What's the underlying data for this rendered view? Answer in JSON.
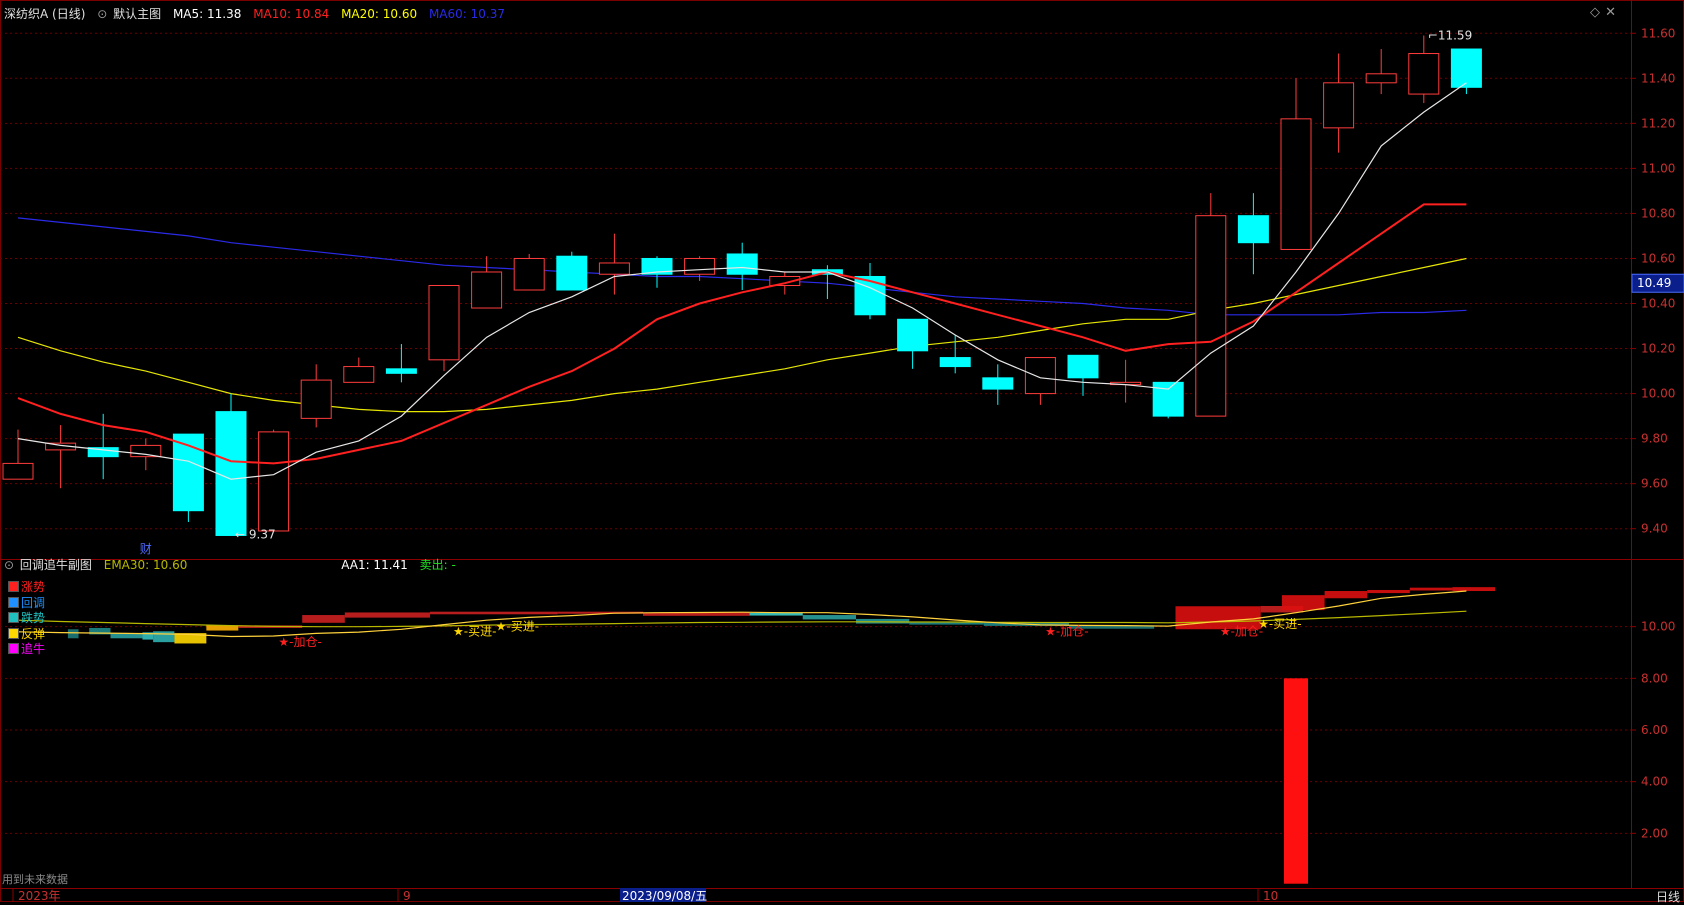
{
  "header": {
    "stock": "深纺织A (日线)",
    "chart_name": "默认主图",
    "indicators": [
      {
        "label": "MA5: 11.38",
        "color": "#ffffff"
      },
      {
        "label": "MA10: 10.84",
        "color": "#ff2020"
      },
      {
        "label": "MA20: 10.60",
        "color": "#ffff00"
      },
      {
        "label": "MA60: 10.37",
        "color": "#1e1ee6"
      }
    ]
  },
  "sub_header": {
    "name": "回调追牛副图",
    "ema": "EMA30: 10.60",
    "aa1": "AA1: 11.41",
    "sell": "卖出: -"
  },
  "legend": [
    {
      "label": "涨势",
      "color": "#ff2020"
    },
    {
      "label": "回调",
      "color": "#1e90ff"
    },
    {
      "label": "跌势",
      "color": "#20c0c0"
    },
    {
      "label": "反弹",
      "color": "#ffd700"
    },
    {
      "label": "追牛",
      "color": "#ff00ff"
    }
  ],
  "footer": {
    "note": "用到未来数据",
    "period_button": "日线",
    "x_labels": [
      "2023年",
      "9",
      "2023/09/08/五",
      "10"
    ]
  },
  "chart_data": {
    "type": "candlestick",
    "main": {
      "yticks": [
        9.4,
        9.6,
        9.8,
        10.0,
        10.2,
        10.4,
        10.6,
        10.8,
        11.0,
        11.2,
        11.4,
        11.6
      ],
      "ylim": [
        9.27,
        11.65
      ],
      "current_price": 10.49,
      "high_label": "11.59",
      "low_label": "9.37",
      "marker_text": "财",
      "candles": [
        {
          "o": 9.62,
          "h": 9.84,
          "l": 9.62,
          "c": 9.69
        },
        {
          "o": 9.75,
          "h": 9.86,
          "l": 9.58,
          "c": 9.78
        },
        {
          "o": 9.76,
          "h": 9.91,
          "l": 9.62,
          "c": 9.72
        },
        {
          "o": 9.72,
          "h": 9.8,
          "l": 9.66,
          "c": 9.77
        },
        {
          "o": 9.82,
          "h": 9.82,
          "l": 9.43,
          "c": 9.48
        },
        {
          "o": 9.92,
          "h": 10.0,
          "l": 9.37,
          "c": 9.37
        },
        {
          "o": 9.39,
          "h": 9.84,
          "l": 9.39,
          "c": 9.83
        },
        {
          "o": 9.89,
          "h": 10.13,
          "l": 9.85,
          "c": 10.06
        },
        {
          "o": 10.05,
          "h": 10.16,
          "l": 10.05,
          "c": 10.12
        },
        {
          "o": 10.11,
          "h": 10.22,
          "l": 10.05,
          "c": 10.09
        },
        {
          "o": 10.15,
          "h": 10.48,
          "l": 10.1,
          "c": 10.48
        },
        {
          "o": 10.38,
          "h": 10.61,
          "l": 10.38,
          "c": 10.54
        },
        {
          "o": 10.46,
          "h": 10.62,
          "l": 10.46,
          "c": 10.6
        },
        {
          "o": 10.61,
          "h": 10.63,
          "l": 10.46,
          "c": 10.46
        },
        {
          "o": 10.53,
          "h": 10.71,
          "l": 10.44,
          "c": 10.58
        },
        {
          "o": 10.6,
          "h": 10.61,
          "l": 10.47,
          "c": 10.53
        },
        {
          "o": 10.53,
          "h": 10.61,
          "l": 10.5,
          "c": 10.6
        },
        {
          "o": 10.62,
          "h": 10.67,
          "l": 10.46,
          "c": 10.53
        },
        {
          "o": 10.48,
          "h": 10.54,
          "l": 10.44,
          "c": 10.52
        },
        {
          "o": 10.55,
          "h": 10.57,
          "l": 10.42,
          "c": 10.53
        },
        {
          "o": 10.52,
          "h": 10.58,
          "l": 10.33,
          "c": 10.35
        },
        {
          "o": 10.33,
          "h": 10.33,
          "l": 10.11,
          "c": 10.19
        },
        {
          "o": 10.16,
          "h": 10.26,
          "l": 10.09,
          "c": 10.12
        },
        {
          "o": 10.07,
          "h": 10.13,
          "l": 9.95,
          "c": 10.02
        },
        {
          "o": 10.0,
          "h": 10.16,
          "l": 9.95,
          "c": 10.16
        },
        {
          "o": 10.17,
          "h": 10.17,
          "l": 9.99,
          "c": 10.07
        },
        {
          "o": 10.04,
          "h": 10.15,
          "l": 9.96,
          "c": 10.05
        },
        {
          "o": 10.05,
          "h": 10.05,
          "l": 9.89,
          "c": 9.9
        },
        {
          "o": 9.9,
          "h": 10.89,
          "l": 9.9,
          "c": 10.79
        },
        {
          "o": 10.79,
          "h": 10.89,
          "l": 10.53,
          "c": 10.67
        },
        {
          "o": 10.64,
          "h": 11.4,
          "l": 10.64,
          "c": 11.22
        },
        {
          "o": 11.18,
          "h": 11.51,
          "l": 11.07,
          "c": 11.38
        },
        {
          "o": 11.38,
          "h": 11.53,
          "l": 11.33,
          "c": 11.42
        },
        {
          "o": 11.33,
          "h": 11.59,
          "l": 11.29,
          "c": 11.51
        },
        {
          "o": 11.53,
          "h": 11.53,
          "l": 11.33,
          "c": 11.36
        }
      ],
      "series": [
        {
          "name": "MA5",
          "color": "#e6e6e6",
          "width": 1.2,
          "values": [
            9.8,
            9.77,
            9.75,
            9.73,
            9.7,
            9.62,
            9.64,
            9.74,
            9.79,
            9.9,
            10.08,
            10.25,
            10.36,
            10.43,
            10.52,
            10.54,
            10.55,
            10.56,
            10.54,
            10.54,
            10.47,
            10.38,
            10.26,
            10.15,
            10.07,
            10.05,
            10.04,
            10.02,
            10.18,
            10.3,
            10.54,
            10.8,
            11.1,
            11.25,
            11.38
          ]
        },
        {
          "name": "MA10",
          "color": "#ff2020",
          "width": 2,
          "values": [
            9.98,
            9.91,
            9.86,
            9.83,
            9.77,
            9.7,
            9.69,
            9.71,
            9.75,
            9.79,
            9.87,
            9.95,
            10.03,
            10.1,
            10.2,
            10.33,
            10.4,
            10.45,
            10.49,
            10.54,
            10.5,
            10.45,
            10.4,
            10.35,
            10.3,
            10.25,
            10.19,
            10.22,
            10.23,
            10.32,
            10.45,
            10.58,
            10.71,
            10.84,
            10.84
          ]
        },
        {
          "name": "MA20",
          "color": "#e6e600",
          "width": 1.2,
          "values": [
            10.25,
            10.19,
            10.14,
            10.1,
            10.05,
            10.0,
            9.97,
            9.95,
            9.93,
            9.92,
            9.92,
            9.93,
            9.95,
            9.97,
            10.0,
            10.02,
            10.05,
            10.08,
            10.11,
            10.15,
            10.18,
            10.21,
            10.23,
            10.25,
            10.28,
            10.31,
            10.33,
            10.33,
            10.37,
            10.4,
            10.44,
            10.48,
            10.52,
            10.56,
            10.6
          ]
        },
        {
          "name": "MA60",
          "color": "#2a2ae8",
          "width": 1.2,
          "values": [
            10.78,
            10.76,
            10.74,
            10.72,
            10.7,
            10.67,
            10.65,
            10.63,
            10.61,
            10.59,
            10.57,
            10.56,
            10.55,
            10.54,
            10.53,
            10.52,
            10.52,
            10.51,
            10.5,
            10.49,
            10.47,
            10.45,
            10.43,
            10.42,
            10.41,
            10.4,
            10.38,
            10.37,
            10.35,
            10.35,
            10.35,
            10.35,
            10.36,
            10.36,
            10.37
          ]
        }
      ]
    },
    "sub": {
      "yticks": [
        2.0,
        4.0,
        6.0,
        8.0,
        10.0
      ],
      "ylim": [
        0.0,
        12.0
      ],
      "aa1_series": {
        "name": "AA1",
        "color": "#ffd23c",
        "values": [
          9.8,
          9.77,
          9.75,
          9.73,
          9.7,
          9.62,
          9.64,
          9.74,
          9.79,
          9.9,
          10.08,
          10.25,
          10.36,
          10.43,
          10.52,
          10.54,
          10.55,
          10.56,
          10.54,
          10.54,
          10.47,
          10.38,
          10.26,
          10.15,
          10.07,
          10.05,
          10.04,
          10.02,
          10.18,
          10.3,
          10.54,
          10.8,
          11.1,
          11.25,
          11.38
        ]
      },
      "ema_series": {
        "name": "EMA30",
        "color": "#b8b800",
        "values": [
          10.25,
          10.2,
          10.16,
          10.12,
          10.08,
          10.04,
          10.01,
          10.0,
          10.0,
          10.01,
          10.03,
          10.06,
          10.08,
          10.1,
          10.12,
          10.14,
          10.16,
          10.17,
          10.18,
          10.19,
          10.19,
          10.18,
          10.18,
          10.17,
          10.16,
          10.16,
          10.16,
          10.15,
          10.18,
          10.22,
          10.28,
          10.35,
          10.43,
          10.51,
          10.6
        ]
      },
      "blocks": [
        {
          "x0": 6,
          "x1": 7,
          "top": 9.9,
          "bot": 9.55,
          "color": "#1e7a7a"
        },
        {
          "x0": 8,
          "x1": 10,
          "top": 9.95,
          "bot": 9.7,
          "color": "#1e8a8a"
        },
        {
          "x0": 10,
          "x1": 13,
          "top": 9.75,
          "bot": 9.55,
          "color": "#2aa0a0"
        },
        {
          "x0": 13,
          "x1": 14,
          "top": 9.78,
          "bot": 9.5,
          "color": "#32c0c0"
        },
        {
          "x0": 14,
          "x1": 16,
          "top": 9.82,
          "bot": 9.4,
          "color": "#2fb0b0"
        },
        {
          "x0": 16,
          "x1": 19,
          "top": 9.75,
          "bot": 9.35,
          "color": "#ffd700"
        },
        {
          "x0": 19,
          "x1": 22,
          "top": 10.05,
          "bot": 9.85,
          "color": "#ffb000"
        },
        {
          "x0": 22,
          "x1": 28,
          "top": 10.05,
          "bot": 9.95,
          "color": "#cc2020"
        },
        {
          "x0": 28,
          "x1": 32,
          "top": 10.45,
          "bot": 10.15,
          "color": "#cc2020"
        },
        {
          "x0": 32,
          "x1": 40,
          "top": 10.55,
          "bot": 10.35,
          "color": "#cc2020"
        },
        {
          "x0": 40,
          "x1": 52,
          "top": 10.58,
          "bot": 10.48,
          "color": "#cc2020"
        },
        {
          "x0": 52,
          "x1": 60,
          "top": 10.58,
          "bot": 10.5,
          "color": "#cc2020"
        },
        {
          "x0": 60,
          "x1": 70,
          "top": 10.55,
          "bot": 10.42,
          "color": "#cc2020"
        },
        {
          "x0": 70,
          "x1": 75,
          "top": 10.53,
          "bot": 10.43,
          "color": "#3acccc"
        },
        {
          "x0": 75,
          "x1": 80,
          "top": 10.45,
          "bot": 10.28,
          "color": "#2aa0a0"
        },
        {
          "x0": 80,
          "x1": 85,
          "top": 10.3,
          "bot": 10.12,
          "color": "#229999"
        },
        {
          "x0": 85,
          "x1": 92,
          "top": 10.16,
          "bot": 10.08,
          "color": "#1e8a8a"
        },
        {
          "x0": 92,
          "x1": 100,
          "top": 10.17,
          "bot": 10.03,
          "color": "#1e8a8a"
        },
        {
          "x0": 100,
          "x1": 108,
          "top": 10.05,
          "bot": 9.92,
          "color": "#1e7a7a"
        },
        {
          "x0": 110,
          "x1": 118,
          "top": 10.79,
          "bot": 9.9,
          "color": "#dd1010"
        },
        {
          "x0": 118,
          "x1": 122,
          "top": 10.8,
          "bot": 10.55,
          "color": "#cc2020"
        },
        {
          "x0": 120,
          "x1": 124,
          "top": 11.22,
          "bot": 10.64,
          "color": "#dd1010"
        },
        {
          "x0": 124,
          "x1": 128,
          "top": 11.38,
          "bot": 11.1,
          "color": "#dd1010"
        },
        {
          "x0": 128,
          "x1": 132,
          "top": 11.42,
          "bot": 11.3,
          "color": "#dd1010"
        },
        {
          "x0": 132,
          "x1": 136,
          "top": 11.51,
          "bot": 11.4,
          "color": "#dd1010"
        },
        {
          "x0": 136,
          "x1": 140,
          "top": 11.53,
          "bot": 11.38,
          "color": "#dd1010"
        }
      ],
      "signals": [
        {
          "i": 6.3,
          "y": 9.45,
          "text": "★-加仓-",
          "color": "#ff2020"
        },
        {
          "i": 10.4,
          "y": 9.85,
          "text": "★-买进-",
          "color": "#ffd700"
        },
        {
          "i": 11.4,
          "y": 10.05,
          "text": "★-买进-",
          "color": "#ffd700"
        },
        {
          "i": 24.3,
          "y": 9.85,
          "text": "★-加仓-",
          "color": "#ff2020"
        },
        {
          "i": 28.4,
          "y": 9.85,
          "text": "★-加仓-",
          "color": "#ff2020"
        },
        {
          "i": 29.3,
          "y": 10.15,
          "text": "★-买进-",
          "color": "#ffd700"
        }
      ],
      "bar": {
        "i": 30,
        "value": 8.0,
        "color": "#ff1010"
      }
    }
  }
}
